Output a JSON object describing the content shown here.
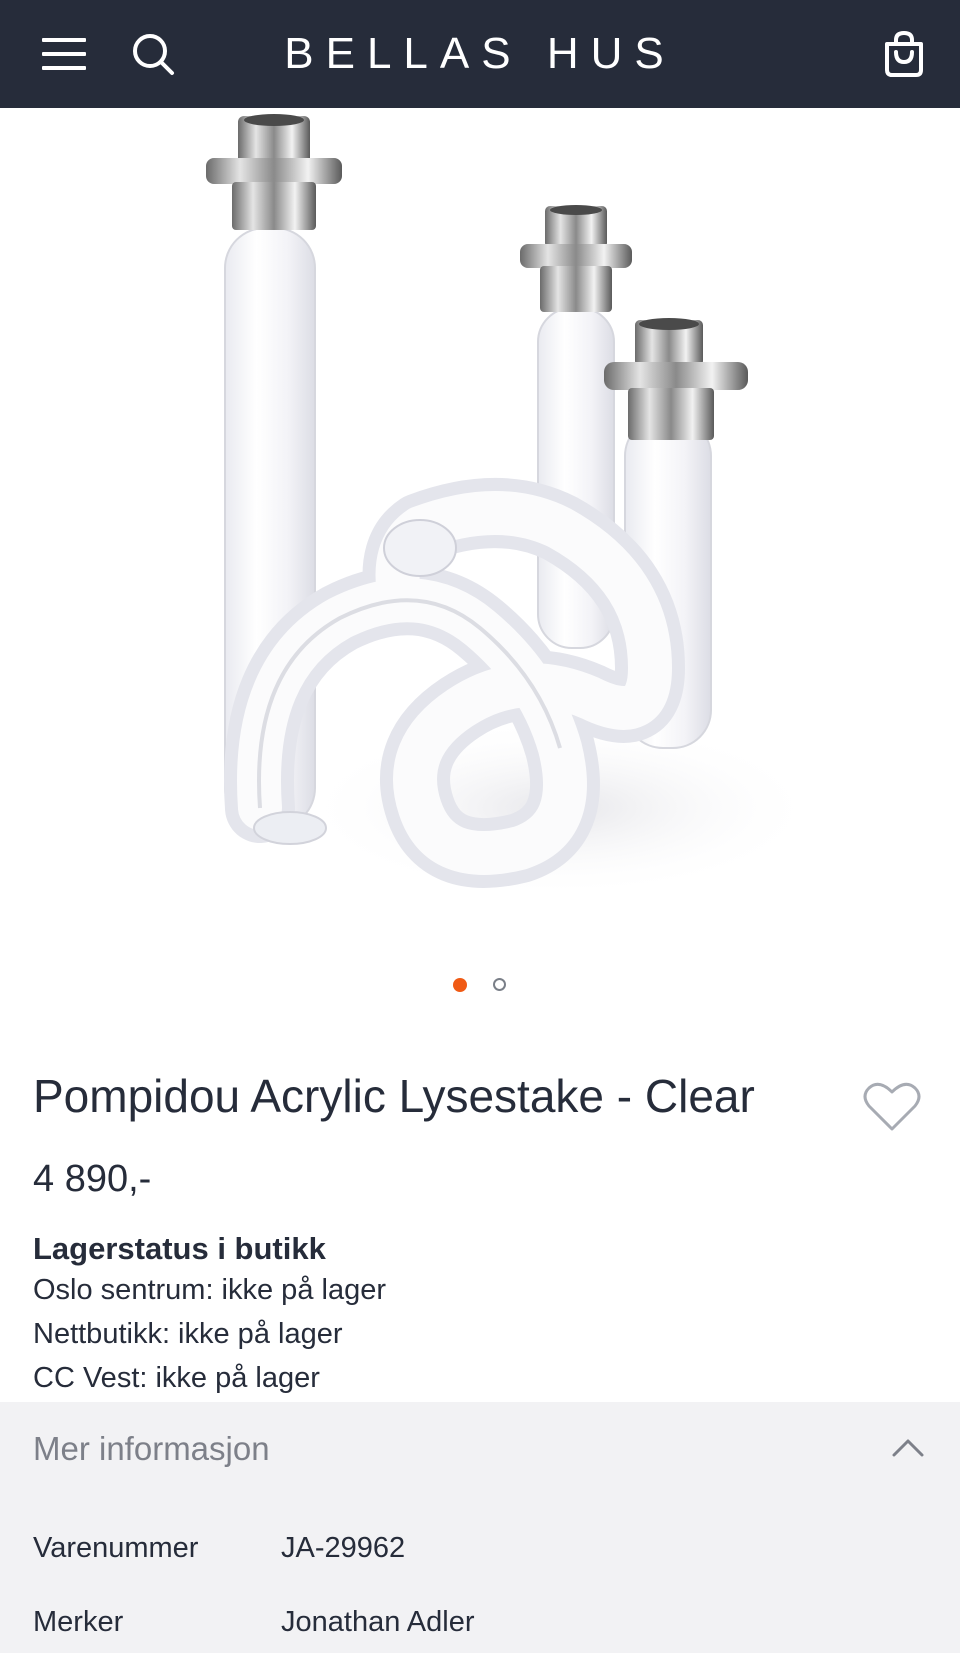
{
  "header": {
    "brand": "BELLAS HUS",
    "icons": {
      "menu": "hamburger-menu-icon",
      "search": "search-icon",
      "cart": "shopping-bag-icon"
    }
  },
  "gallery": {
    "slide_count": 2,
    "active_index": 0,
    "accent_color": "#f05a14"
  },
  "product": {
    "title": "Pompidou Acrylic Lysestake - Clear",
    "price": "4 890,-",
    "wishlist_icon": "heart-icon"
  },
  "stock": {
    "heading": "Lagerstatus i butikk",
    "lines": [
      "Oslo sentrum: ikke på lager",
      "Nettbutikk: ikke på lager",
      "CC Vest: ikke på lager"
    ]
  },
  "more_info": {
    "label": "Mer informasjon",
    "expanded": true,
    "specs": [
      {
        "key": "Varenummer",
        "value": "JA-29962"
      },
      {
        "key": "Merker",
        "value": "Jonathan Adler"
      }
    ]
  },
  "colors": {
    "header_bg": "#262c3a",
    "text": "#262c3a",
    "panel_bg": "#f2f2f4",
    "muted": "#7d8089"
  }
}
